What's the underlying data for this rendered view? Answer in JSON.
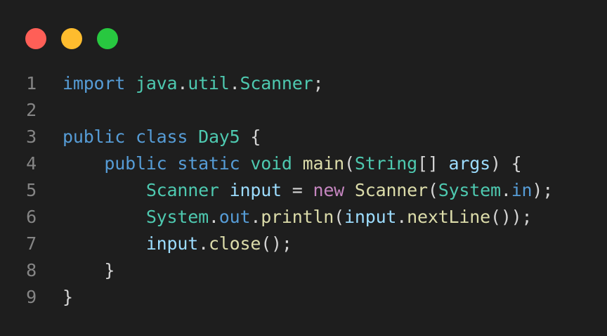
{
  "colors": {
    "background": "#1e1e1e",
    "close_dot": "#ff5f57",
    "minimize_dot": "#febc2e",
    "maximize_dot": "#28c840",
    "keyword": "#569cd6",
    "type": "#4ec9b0",
    "function": "#dcdcaa",
    "variable": "#9cdcfe",
    "control": "#c586c0",
    "punctuation": "#d4d4d4",
    "line_number": "#858585"
  },
  "window_controls": [
    {
      "name": "close-dot",
      "color": "#ff5f57"
    },
    {
      "name": "minimize-dot",
      "color": "#febc2e"
    },
    {
      "name": "maximize-dot",
      "color": "#28c840"
    }
  ],
  "code_lines": [
    {
      "number": "1",
      "tokens": [
        {
          "text": "import",
          "kind": "keyword"
        },
        {
          "text": " ",
          "kind": "punctuation"
        },
        {
          "text": "java",
          "kind": "type"
        },
        {
          "text": ".",
          "kind": "punctuation"
        },
        {
          "text": "util",
          "kind": "type"
        },
        {
          "text": ".",
          "kind": "punctuation"
        },
        {
          "text": "Scanner",
          "kind": "type"
        },
        {
          "text": ";",
          "kind": "punctuation"
        }
      ]
    },
    {
      "number": "2",
      "tokens": []
    },
    {
      "number": "3",
      "tokens": [
        {
          "text": "public",
          "kind": "keyword"
        },
        {
          "text": " ",
          "kind": "punctuation"
        },
        {
          "text": "class",
          "kind": "keyword"
        },
        {
          "text": " ",
          "kind": "punctuation"
        },
        {
          "text": "Day5",
          "kind": "type"
        },
        {
          "text": " {",
          "kind": "punctuation"
        }
      ]
    },
    {
      "number": "4",
      "tokens": [
        {
          "text": "    ",
          "kind": "punctuation"
        },
        {
          "text": "public",
          "kind": "keyword"
        },
        {
          "text": " ",
          "kind": "punctuation"
        },
        {
          "text": "static",
          "kind": "keyword"
        },
        {
          "text": " ",
          "kind": "punctuation"
        },
        {
          "text": "void",
          "kind": "type"
        },
        {
          "text": " ",
          "kind": "punctuation"
        },
        {
          "text": "main",
          "kind": "function"
        },
        {
          "text": "(",
          "kind": "punctuation"
        },
        {
          "text": "String",
          "kind": "type"
        },
        {
          "text": "[] ",
          "kind": "punctuation"
        },
        {
          "text": "args",
          "kind": "variable"
        },
        {
          "text": ") {",
          "kind": "punctuation"
        }
      ]
    },
    {
      "number": "5",
      "tokens": [
        {
          "text": "        ",
          "kind": "punctuation"
        },
        {
          "text": "Scanner",
          "kind": "type"
        },
        {
          "text": " ",
          "kind": "punctuation"
        },
        {
          "text": "input",
          "kind": "variable"
        },
        {
          "text": " = ",
          "kind": "punctuation"
        },
        {
          "text": "new",
          "kind": "control"
        },
        {
          "text": " ",
          "kind": "punctuation"
        },
        {
          "text": "Scanner",
          "kind": "function"
        },
        {
          "text": "(",
          "kind": "punctuation"
        },
        {
          "text": "System",
          "kind": "type"
        },
        {
          "text": ".",
          "kind": "punctuation"
        },
        {
          "text": "in",
          "kind": "keyword"
        },
        {
          "text": ");",
          "kind": "punctuation"
        }
      ]
    },
    {
      "number": "6",
      "tokens": [
        {
          "text": "        ",
          "kind": "punctuation"
        },
        {
          "text": "System",
          "kind": "type"
        },
        {
          "text": ".",
          "kind": "punctuation"
        },
        {
          "text": "out",
          "kind": "keyword"
        },
        {
          "text": ".",
          "kind": "punctuation"
        },
        {
          "text": "println",
          "kind": "function"
        },
        {
          "text": "(",
          "kind": "punctuation"
        },
        {
          "text": "input",
          "kind": "variable"
        },
        {
          "text": ".",
          "kind": "punctuation"
        },
        {
          "text": "nextLine",
          "kind": "function"
        },
        {
          "text": "());",
          "kind": "punctuation"
        }
      ]
    },
    {
      "number": "7",
      "tokens": [
        {
          "text": "        ",
          "kind": "punctuation"
        },
        {
          "text": "input",
          "kind": "variable"
        },
        {
          "text": ".",
          "kind": "punctuation"
        },
        {
          "text": "close",
          "kind": "function"
        },
        {
          "text": "();",
          "kind": "punctuation"
        }
      ]
    },
    {
      "number": "8",
      "tokens": [
        {
          "text": "    }",
          "kind": "punctuation"
        }
      ]
    },
    {
      "number": "9",
      "tokens": [
        {
          "text": "}",
          "kind": "punctuation"
        }
      ]
    }
  ]
}
